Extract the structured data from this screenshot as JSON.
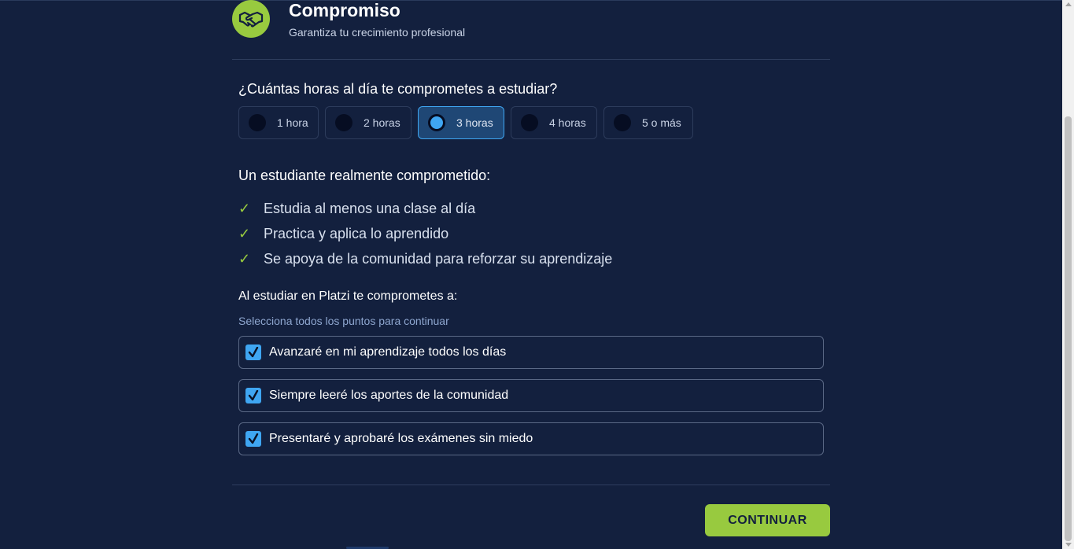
{
  "header": {
    "icon": "handshake-icon",
    "title": "Compromiso",
    "subtitle": "Garantiza tu crecimiento profesional"
  },
  "hours": {
    "question": "¿Cuántas horas al día te comprometes a estudiar?",
    "options": [
      {
        "label": "1 hora",
        "selected": false
      },
      {
        "label": "2 horas",
        "selected": false
      },
      {
        "label": "3 horas",
        "selected": true
      },
      {
        "label": "4 horas",
        "selected": false
      },
      {
        "label": "5 o más",
        "selected": false
      }
    ]
  },
  "committed_student": {
    "title": "Un estudiante realmente comprometido:",
    "check_symbol": "✓",
    "items": [
      "Estudia al menos una clase al día",
      "Practica y aplica lo aprendido",
      "Se apoya de la comunidad para reforzar su aprendizaje"
    ]
  },
  "pledge": {
    "title": "Al estudiar en Platzi te comprometes a:",
    "hint": "Selecciona todos los puntos para continuar",
    "items": [
      {
        "label": "Avanzaré en mi aprendizaje todos los días",
        "checked": true
      },
      {
        "label": "Siempre leeré los aportes de la comunidad",
        "checked": true
      },
      {
        "label": "Presentaré y aprobaré los exámenes sin miedo",
        "checked": true
      }
    ]
  },
  "actions": {
    "continue_label": "CONTINUAR"
  },
  "colors": {
    "background": "#13203e",
    "accent_green": "#98ca3f",
    "accent_blue": "#3fa6f2"
  }
}
